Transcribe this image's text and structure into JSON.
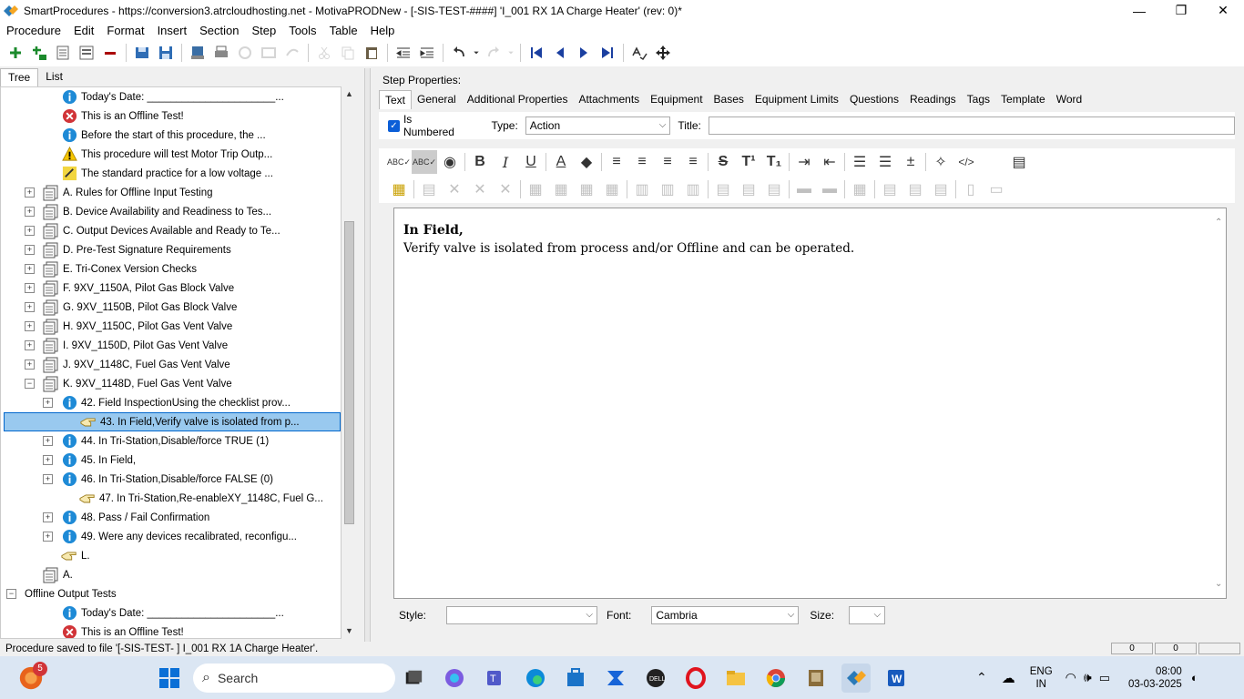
{
  "window": {
    "title": "SmartProcedures - https://conversion3.atrcloudhosting.net - MotivaPRODNew - [-SIS-TEST-####] 'I_001 RX 1A Charge Heater' (rev: 0)*",
    "minimize": "—",
    "maximize": "❐",
    "close": "✕"
  },
  "menu": [
    {
      "label": "Procedure"
    },
    {
      "label": "Edit"
    },
    {
      "label": "Format"
    },
    {
      "label": "Insert"
    },
    {
      "label": "Section"
    },
    {
      "label": "Step"
    },
    {
      "label": "Tools"
    },
    {
      "label": "Table"
    },
    {
      "label": "Help"
    }
  ],
  "left_tabs": {
    "tree": "Tree",
    "list": "List"
  },
  "tree": [
    {
      "text": "Today's Date: ______________________...",
      "icon": "info"
    },
    {
      "text": "This is an Offline Test!",
      "icon": "error"
    },
    {
      "text": "Before the start of this procedure, the ...",
      "icon": "info"
    },
    {
      "text": "This procedure will test Motor Trip Outp...",
      "icon": "warning"
    },
    {
      "text": "The standard practice for a low voltage ...",
      "icon": "note"
    },
    {
      "text": "A. Rules for Offline Input Testing",
      "icon": "section",
      "exp": "+"
    },
    {
      "text": "B. Device Availability and Readiness to Tes...",
      "icon": "section",
      "exp": "+"
    },
    {
      "text": "C. Output Devices Available and Ready to Te...",
      "icon": "section",
      "exp": "+"
    },
    {
      "text": "D. Pre-Test Signature Requirements",
      "icon": "section",
      "exp": "+"
    },
    {
      "text": "E. Tri-Conex Version Checks",
      "icon": "section",
      "exp": "+"
    },
    {
      "text": "F. 9XV_1150A, Pilot Gas Block Valve",
      "icon": "section",
      "exp": "+"
    },
    {
      "text": "G. 9XV_1150B, Pilot Gas Block Valve",
      "icon": "section",
      "exp": "+"
    },
    {
      "text": "H. 9XV_1150C, Pilot Gas Vent Valve",
      "icon": "section",
      "exp": "+"
    },
    {
      "text": "I. 9XV_1150D, Pilot Gas Vent Valve",
      "icon": "section",
      "exp": "+"
    },
    {
      "text": "J. 9XV_1148C, Fuel Gas Vent Valve",
      "icon": "section",
      "exp": "+"
    },
    {
      "text": "K. 9XV_1148D, Fuel Gas Vent Valve",
      "icon": "section",
      "exp": "−"
    },
    {
      "text": "42. Field InspectionUsing the checklist prov...",
      "icon": "info",
      "exp": "+"
    },
    {
      "text": "43. In Field,Verify valve is isolated from p...",
      "icon": "hand",
      "selected": true
    },
    {
      "text": "44. In Tri-Station,Disable/force TRUE (1)",
      "icon": "info",
      "exp": "+"
    },
    {
      "text": "45. In Field,",
      "icon": "info",
      "exp": "+"
    },
    {
      "text": "46. In Tri-Station,Disable/force FALSE (0)",
      "icon": "info",
      "exp": "+"
    },
    {
      "text": "47. In Tri-Station,Re-enableXY_1148C, Fuel G...",
      "icon": "hand"
    },
    {
      "text": "48. Pass / Fail Confirmation",
      "icon": "info",
      "exp": "+"
    },
    {
      "text": "49. Were any devices recalibrated, reconfigu...",
      "icon": "info",
      "exp": "+"
    },
    {
      "text": "L.",
      "icon": "hand"
    },
    {
      "text": "A.",
      "icon": "section"
    },
    {
      "text": "Offline Output Tests",
      "icon": "none",
      "exp": "−"
    },
    {
      "text": "Today's Date: ______________________...",
      "icon": "info"
    },
    {
      "text": "This is an Offline Test!",
      "icon": "error"
    }
  ],
  "step_properties": {
    "label": "Step Properties:",
    "tabs": [
      "Text",
      "General",
      "Additional Properties",
      "Attachments",
      "Equipment",
      "Bases",
      "Equipment Limits",
      "Questions",
      "Readings",
      "Tags",
      "Template",
      "Word"
    ],
    "is_numbered_label": "Is Numbered",
    "type_label": "Type:",
    "type_value": "Action",
    "title_label": "Title:",
    "title_value": ""
  },
  "editor": {
    "line1": "In Field,",
    "line2": "Verify valve is isolated from process and/or Offline and can be operated."
  },
  "format_row": {
    "style_label": "Style:",
    "style_value": "",
    "font_label": "Font:",
    "font_value": "Cambria",
    "size_label": "Size:",
    "size_value": ""
  },
  "statusbar": {
    "text": "Procedure saved to file '[-SIS-TEST-    ] I_001 RX 1A Charge Heater'.",
    "pane1": "0",
    "pane2": "0"
  },
  "taskbar": {
    "search_label": "Search",
    "notification_badge": "5",
    "language_top": "ENG",
    "language_bottom": "IN",
    "time": "08:00",
    "date": "03-03-2025"
  },
  "colors": {
    "selected_bg": "#99c9ef",
    "accent": "#0b5ed7",
    "taskbar_bg": "#dbe6f3"
  }
}
